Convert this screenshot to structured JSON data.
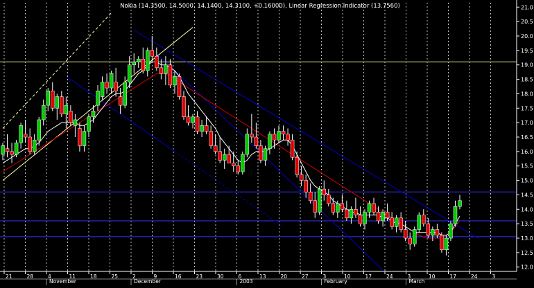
{
  "chart_data": {
    "type": "candlestick",
    "title": "Nokia (14.3500, 14.5000, 14.1400, 14.3100, +0.16000), Linear Regression Indicator (13.7560)",
    "ylim": [
      11.85,
      21.15
    ],
    "y_ticks": [
      12.0,
      12.5,
      13.0,
      13.5,
      14.0,
      14.5,
      15.0,
      15.5,
      16.0,
      16.5,
      17.0,
      17.5,
      18.0,
      18.5,
      19.0,
      19.5,
      20.0,
      20.5,
      21.0
    ],
    "x_ticks": [
      "21",
      "28",
      "4",
      "11",
      "18",
      "25",
      "2",
      "9",
      "16",
      "23",
      "30",
      "6",
      "13",
      "20",
      "27",
      "3",
      "10",
      "17",
      "24",
      "3",
      "10",
      "17",
      "24",
      "3"
    ],
    "period_labels": [
      {
        "label": "November",
        "at": 2
      },
      {
        "label": "December",
        "at": 6
      },
      {
        "label": "2003",
        "at": 11
      },
      {
        "label": "February",
        "at": 15
      },
      {
        "label": "March",
        "at": 19
      }
    ],
    "horizontal_levels": [
      {
        "value": 19.1,
        "color": "#ffffaa"
      },
      {
        "value": 14.6,
        "color": "#3333ff"
      },
      {
        "value": 13.6,
        "color": "#3333ff"
      },
      {
        "value": 13.05,
        "color": "#3333ff"
      }
    ],
    "colors": {
      "background": "#000000",
      "grid": "#ffffff",
      "up_candle": "#00cc00",
      "down_candle": "#dd0000",
      "linear_regression": "#ffffff",
      "moving_average": "#cc0000",
      "channel": "#0000cc",
      "trendline": "#ffffaa",
      "axis_text": "#ffffff"
    },
    "series": [
      {
        "name": "Nokia",
        "ohlc": [
          [
            15.9,
            16.3,
            15.7,
            16.2
          ],
          [
            16.1,
            16.6,
            15.8,
            16.0
          ],
          [
            16.0,
            16.3,
            15.6,
            15.9
          ],
          [
            15.9,
            16.4,
            15.8,
            16.3
          ],
          [
            16.3,
            17.0,
            16.1,
            16.9
          ],
          [
            16.6,
            17.1,
            16.3,
            16.5
          ],
          [
            16.5,
            16.8,
            15.9,
            16.0
          ],
          [
            16.0,
            16.6,
            15.9,
            16.4
          ],
          [
            16.4,
            17.2,
            16.2,
            17.1
          ],
          [
            17.1,
            17.8,
            16.9,
            17.6
          ],
          [
            17.6,
            18.2,
            17.4,
            18.1
          ],
          [
            18.1,
            18.4,
            17.4,
            17.5
          ],
          [
            17.5,
            18.0,
            17.1,
            17.9
          ],
          [
            17.9,
            18.1,
            17.2,
            17.3
          ],
          [
            17.3,
            17.9,
            16.8,
            17.6
          ],
          [
            17.4,
            17.6,
            16.9,
            17.0
          ],
          [
            16.9,
            17.3,
            16.5,
            17.1
          ],
          [
            16.8,
            17.0,
            16.0,
            16.2
          ],
          [
            16.2,
            16.9,
            16.0,
            16.7
          ],
          [
            16.7,
            17.3,
            16.5,
            17.2
          ],
          [
            17.2,
            17.6,
            17.0,
            17.4
          ],
          [
            17.6,
            18.3,
            17.4,
            18.1
          ],
          [
            17.9,
            18.6,
            17.8,
            18.4
          ],
          [
            18.4,
            18.7,
            18.0,
            18.2
          ],
          [
            18.2,
            18.8,
            18.0,
            18.7
          ],
          [
            18.4,
            18.9,
            17.9,
            18.1
          ],
          [
            17.9,
            18.2,
            17.3,
            17.6
          ],
          [
            17.6,
            18.6,
            17.5,
            18.4
          ],
          [
            18.4,
            19.3,
            18.2,
            19.0
          ],
          [
            19.0,
            19.4,
            18.7,
            19.1
          ],
          [
            19.1,
            19.3,
            18.9,
            19.2
          ],
          [
            19.2,
            19.6,
            18.7,
            18.8
          ],
          [
            18.8,
            19.6,
            18.6,
            19.5
          ],
          [
            19.5,
            20.0,
            19.1,
            19.3
          ],
          [
            19.3,
            19.6,
            18.8,
            18.9
          ],
          [
            18.9,
            19.2,
            18.5,
            18.7
          ],
          [
            18.7,
            19.3,
            18.3,
            19.0
          ],
          [
            19.0,
            19.2,
            18.2,
            18.3
          ],
          [
            18.3,
            18.8,
            18.0,
            18.6
          ],
          [
            18.6,
            18.7,
            17.8,
            17.9
          ],
          [
            17.9,
            18.1,
            17.1,
            17.2
          ],
          [
            17.2,
            17.6,
            16.9,
            17.0
          ],
          [
            17.0,
            17.3,
            16.8,
            17.2
          ],
          [
            17.2,
            17.4,
            16.6,
            16.7
          ],
          [
            16.7,
            17.1,
            16.5,
            16.9
          ],
          [
            16.9,
            17.2,
            16.6,
            16.7
          ],
          [
            16.7,
            16.9,
            16.1,
            16.2
          ],
          [
            16.2,
            16.6,
            15.9,
            16.0
          ],
          [
            16.0,
            16.5,
            15.6,
            15.7
          ],
          [
            15.7,
            16.1,
            15.4,
            15.9
          ],
          [
            15.9,
            16.2,
            15.6,
            15.6
          ],
          [
            15.6,
            16.0,
            15.3,
            15.5
          ],
          [
            15.5,
            15.7,
            15.2,
            15.3
          ],
          [
            15.3,
            16.0,
            15.2,
            15.9
          ],
          [
            15.9,
            16.8,
            15.8,
            16.6
          ],
          [
            16.6,
            17.3,
            16.3,
            16.5
          ],
          [
            16.5,
            17.0,
            16.1,
            16.2
          ],
          [
            16.2,
            16.4,
            15.6,
            15.7
          ],
          [
            15.7,
            16.2,
            15.5,
            16.1
          ],
          [
            16.1,
            16.7,
            15.9,
            16.6
          ],
          [
            16.6,
            16.8,
            16.1,
            16.4
          ],
          [
            16.4,
            16.9,
            16.3,
            16.7
          ],
          [
            16.7,
            16.9,
            16.4,
            16.6
          ],
          [
            16.6,
            16.8,
            16.2,
            16.4
          ],
          [
            16.4,
            16.6,
            15.7,
            15.8
          ],
          [
            15.8,
            16.0,
            15.1,
            15.2
          ],
          [
            15.2,
            15.5,
            14.8,
            15.0
          ],
          [
            15.0,
            15.2,
            14.4,
            14.6
          ],
          [
            14.6,
            14.9,
            14.2,
            14.3
          ],
          [
            14.3,
            14.6,
            13.7,
            13.9
          ],
          [
            13.9,
            14.8,
            13.8,
            14.7
          ],
          [
            14.7,
            15.0,
            14.3,
            14.5
          ],
          [
            14.5,
            14.7,
            14.1,
            14.2
          ],
          [
            14.2,
            14.4,
            13.8,
            13.9
          ],
          [
            13.9,
            14.3,
            13.7,
            14.2
          ],
          [
            14.2,
            14.5,
            13.9,
            14.0
          ],
          [
            14.0,
            14.3,
            13.6,
            13.7
          ],
          [
            13.7,
            14.1,
            13.5,
            14.0
          ],
          [
            14.0,
            14.4,
            13.7,
            13.8
          ],
          [
            13.8,
            14.1,
            13.4,
            13.5
          ],
          [
            13.5,
            14.0,
            13.3,
            13.9
          ],
          [
            13.9,
            14.3,
            13.7,
            14.2
          ],
          [
            14.2,
            14.4,
            13.8,
            13.9
          ],
          [
            13.9,
            14.1,
            13.5,
            13.6
          ],
          [
            13.6,
            14.0,
            13.4,
            13.9
          ],
          [
            13.9,
            14.2,
            13.6,
            13.7
          ],
          [
            13.7,
            13.9,
            13.3,
            13.4
          ],
          [
            13.4,
            13.8,
            13.2,
            13.7
          ],
          [
            13.7,
            13.9,
            13.2,
            13.3
          ],
          [
            13.3,
            13.6,
            12.9,
            13.0
          ],
          [
            13.0,
            13.2,
            12.6,
            12.8
          ],
          [
            12.8,
            13.4,
            12.7,
            13.3
          ],
          [
            13.3,
            13.9,
            13.2,
            13.8
          ],
          [
            13.8,
            14.0,
            13.4,
            13.5
          ],
          [
            13.5,
            13.7,
            13.0,
            13.1
          ],
          [
            13.1,
            13.4,
            12.9,
            13.3
          ],
          [
            13.3,
            13.5,
            13.0,
            13.1
          ],
          [
            13.1,
            13.2,
            12.5,
            12.6
          ],
          [
            12.6,
            13.1,
            12.4,
            13.0
          ],
          [
            13.0,
            13.6,
            12.9,
            13.5
          ],
          [
            13.5,
            14.3,
            13.4,
            14.1
          ],
          [
            14.1,
            14.5,
            14.0,
            14.3
          ]
        ]
      },
      {
        "name": "Linear Regression Indicator",
        "line": [
          15.6,
          15.7,
          15.8,
          15.9,
          16.0,
          16.1,
          16.1,
          16.2,
          16.3,
          16.5,
          16.7,
          16.8,
          16.9,
          17.0,
          17.0,
          17.0,
          17.0,
          16.9,
          16.9,
          17.0,
          17.1,
          17.3,
          17.5,
          17.7,
          17.9,
          18.0,
          18.0,
          18.1,
          18.3,
          18.5,
          18.7,
          18.8,
          19.0,
          19.1,
          19.1,
          19.0,
          19.0,
          18.9,
          18.8,
          18.6,
          18.3,
          18.0,
          17.8,
          17.6,
          17.4,
          17.2,
          17.0,
          16.8,
          16.5,
          16.3,
          16.1,
          15.9,
          15.7,
          15.6,
          15.7,
          15.9,
          16.0,
          16.0,
          16.0,
          16.1,
          16.2,
          16.3,
          16.4,
          16.4,
          16.2,
          15.9,
          15.6,
          15.3,
          15.0,
          14.8,
          14.7,
          14.6,
          14.5,
          14.3,
          14.2,
          14.1,
          14.0,
          13.9,
          13.9,
          13.8,
          13.8,
          13.8,
          13.8,
          13.8,
          13.7,
          13.7,
          13.6,
          13.5,
          13.5,
          13.4,
          13.3,
          13.2,
          13.2,
          13.2,
          13.2,
          13.2,
          13.2,
          13.1,
          13.1,
          13.2,
          13.5,
          13.76
        ]
      },
      {
        "name": "Moving Average",
        "line": [
          15.3,
          15.4,
          15.5,
          15.6,
          15.7,
          15.8,
          15.9,
          16.0,
          16.1,
          16.2,
          16.3,
          16.4,
          16.5,
          16.6,
          16.7,
          16.8,
          16.9,
          17.0,
          17.1,
          17.2,
          17.3,
          17.4,
          17.5,
          17.6,
          17.7,
          17.8,
          17.9,
          18.0,
          18.1,
          18.2,
          18.3,
          18.4,
          18.5,
          18.6,
          18.7,
          18.7,
          18.7,
          18.6,
          18.5,
          18.4,
          18.3,
          18.2,
          18.1,
          18.0,
          17.9,
          17.8,
          17.7,
          17.6,
          17.5,
          17.4,
          17.3,
          17.2,
          17.1,
          17.0,
          16.9,
          16.8,
          16.7,
          16.6,
          16.5,
          16.4,
          16.3,
          16.2,
          16.1,
          16.0,
          15.9,
          15.8,
          15.7,
          15.6,
          15.5,
          15.4,
          15.3,
          15.2,
          15.1,
          15.0,
          14.9,
          14.8,
          14.7,
          14.6,
          14.5,
          14.4,
          14.3,
          14.2,
          14.1,
          14.0,
          13.9,
          13.8,
          13.7,
          13.6,
          13.5,
          13.4,
          13.3,
          13.2,
          13.1,
          13.05,
          13.0,
          13.0,
          13.0,
          13.0,
          13.1,
          13.2,
          13.4,
          13.6
        ]
      }
    ]
  }
}
